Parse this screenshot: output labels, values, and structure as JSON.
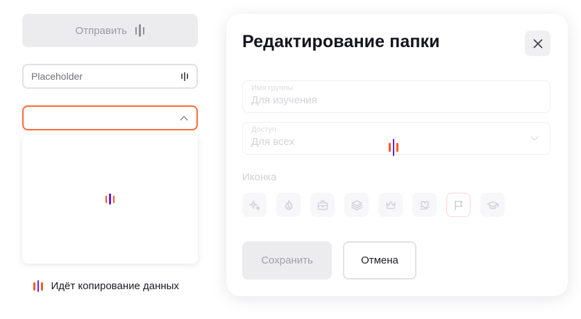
{
  "left": {
    "send_button": {
      "label": "Отправить"
    },
    "placeholder_input": {
      "placeholder": "Placeholder"
    },
    "copy_status": {
      "text": "Идёт копирование данных"
    }
  },
  "dialog": {
    "title": "Редактирование папки",
    "group_name_field": {
      "label": "Имя группы",
      "value": "Для изучения"
    },
    "access_field": {
      "label": "Доступ",
      "value": "Для всех"
    },
    "icons_label": "Иконка",
    "icons": [
      "sparkles-icon",
      "fire-icon",
      "briefcase-icon",
      "layers-icon",
      "crown-icon",
      "heart-hand-icon",
      "flag-icon",
      "graduation-cap-icon"
    ],
    "selected_icon": "flag-icon",
    "save_button": "Сохранить",
    "cancel_button": "Отмена"
  },
  "colors": {
    "loader_orange": "#ff5a1f",
    "loader_purple": "#6a1be6",
    "accent_border": "#ff6a33"
  }
}
